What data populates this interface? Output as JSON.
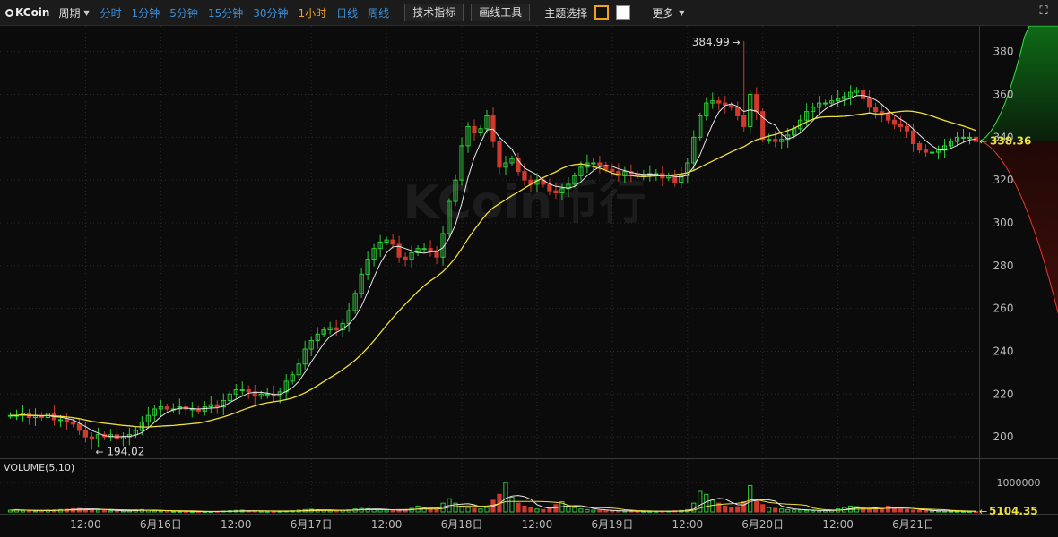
{
  "toolbar": {
    "logo_text": "KCoin",
    "period_label": "周期",
    "intervals": [
      "分时",
      "1分钟",
      "5分钟",
      "15分钟",
      "30分钟",
      "1小时",
      "日线",
      "周线"
    ],
    "active_interval": "1小时",
    "indicator_button": "技术指标",
    "drawing_button": "画线工具",
    "theme_label": "主题选择",
    "more_label": "更多"
  },
  "watermark": "KCoin币行",
  "colors": {
    "up": "#2fcc3a",
    "down": "#d03a2e",
    "ma5": "#e8e8e8",
    "ma10": "#f0e03a",
    "accent": "#f0a020",
    "link": "#3b8fd8"
  },
  "chart_data": {
    "type": "candlestick",
    "price_axis": {
      "ticks": [
        200,
        220,
        240,
        260,
        280,
        300,
        320,
        340,
        360,
        380
      ],
      "range": [
        190,
        392
      ]
    },
    "x_labels": [
      {
        "label": "12:00",
        "index": 12
      },
      {
        "label": "6月16日",
        "index": 24
      },
      {
        "label": "12:00",
        "index": 36
      },
      {
        "label": "6月17日",
        "index": 48
      },
      {
        "label": "12:00",
        "index": 60
      },
      {
        "label": "6月18日",
        "index": 72
      },
      {
        "label": "12:00",
        "index": 84
      },
      {
        "label": "6月19日",
        "index": 96
      },
      {
        "label": "12:00",
        "index": 108
      },
      {
        "label": "6月20日",
        "index": 120
      },
      {
        "label": "12:00",
        "index": 132
      },
      {
        "label": "6月21日",
        "index": 144
      }
    ],
    "closes": [
      210,
      210,
      211,
      209,
      210,
      209,
      211,
      208,
      208,
      207,
      206,
      203,
      200,
      199,
      201,
      200,
      201,
      199,
      200,
      201,
      203,
      207,
      210,
      213,
      214,
      213,
      213,
      214,
      213,
      213,
      212,
      214,
      215,
      214,
      217,
      220,
      222,
      222,
      221,
      219,
      220,
      220,
      219,
      221,
      226,
      229,
      234,
      241,
      245,
      248,
      250,
      251,
      250,
      253,
      259,
      267,
      276,
      283,
      288,
      291,
      292,
      290,
      284,
      283,
      286,
      288,
      288,
      287,
      284,
      295,
      310,
      320,
      336,
      345,
      342,
      344,
      350,
      338,
      326,
      328,
      330,
      324,
      320,
      318,
      320,
      318,
      315,
      314,
      316,
      318,
      322,
      326,
      328,
      328,
      327,
      325,
      324,
      322,
      324,
      323,
      322,
      322,
      323,
      323,
      321,
      322,
      319,
      322,
      328,
      340,
      350,
      356,
      357,
      356,
      355,
      354,
      350,
      345,
      360,
      352,
      339,
      339,
      338,
      339,
      341,
      344,
      348,
      352,
      354,
      356,
      356,
      357,
      358,
      359,
      361,
      362,
      358,
      354,
      352,
      351,
      348,
      346,
      345,
      343,
      337,
      334,
      333,
      333,
      334,
      336,
      338,
      340,
      340,
      340,
      338
    ],
    "high_label": "384.99",
    "high_index": 117,
    "low_label": "194.02",
    "low_index": 13,
    "last_price": "338.36",
    "last_price_value": 338.36,
    "volume_panel": {
      "title": "VOLUME(5,10)",
      "tick_label": "1000000",
      "tick_value": 1000000,
      "last_volume": "5104.35",
      "max_value": 1400000,
      "values": [
        60000,
        80000,
        50000,
        40000,
        30000,
        45000,
        60000,
        70000,
        80000,
        90000,
        110000,
        120000,
        100000,
        90000,
        60000,
        50000,
        40000,
        30000,
        35000,
        50000,
        70000,
        80000,
        60000,
        40000,
        30000,
        25000,
        20000,
        18000,
        15000,
        12000,
        10000,
        12000,
        15000,
        20000,
        30000,
        40000,
        50000,
        60000,
        40000,
        30000,
        25000,
        20000,
        18000,
        22000,
        30000,
        40000,
        60000,
        80000,
        90000,
        70000,
        50000,
        40000,
        50000,
        60000,
        70000,
        100000,
        120000,
        110000,
        80000,
        70000,
        60000,
        50000,
        60000,
        80000,
        120000,
        200000,
        150000,
        100000,
        80000,
        300000,
        450000,
        300000,
        200000,
        150000,
        120000,
        100000,
        200000,
        400000,
        600000,
        1000000,
        500000,
        300000,
        200000,
        150000,
        100000,
        80000,
        120000,
        250000,
        350000,
        200000,
        150000,
        100000,
        80000,
        60000,
        50000,
        40000,
        35000,
        30000,
        28000,
        25000,
        22000,
        20000,
        18000,
        20000,
        25000,
        30000,
        40000,
        50000,
        80000,
        300000,
        700000,
        600000,
        400000,
        300000,
        200000,
        150000,
        180000,
        350000,
        900000,
        400000,
        250000,
        150000,
        120000,
        100000,
        80000,
        70000,
        60000,
        50000,
        45000,
        40000,
        45000,
        60000,
        100000,
        150000,
        200000,
        180000,
        120000,
        100000,
        80000,
        120000,
        200000,
        150000,
        100000,
        80000,
        60000,
        50000,
        40000,
        35000,
        30000,
        25000,
        22000,
        20000,
        18000,
        15000,
        12000
      ]
    }
  }
}
